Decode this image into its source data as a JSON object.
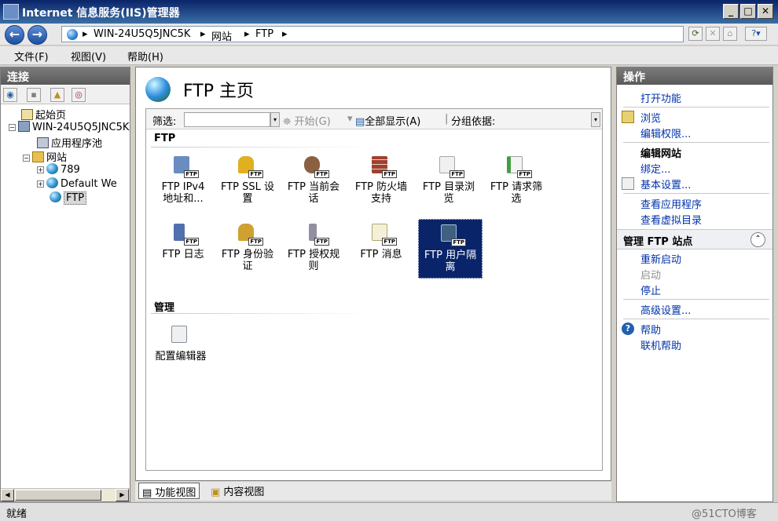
{
  "window": {
    "title": "Internet 信息服务(IIS)管理器",
    "min": "_",
    "max": "□",
    "close": "✕"
  },
  "address": {
    "back": "←",
    "forward": "→",
    "breadcrumb": [
      "WIN-24U5Q5JNC5K",
      "网站",
      "FTP"
    ],
    "sep": "▸",
    "help": "?"
  },
  "menu": [
    "文件(F)",
    "视图(V)",
    "帮助(H)"
  ],
  "connections": {
    "title": "连接",
    "tree": [
      {
        "label": "起始页",
        "icon": "start-page-icon",
        "level": 0
      },
      {
        "label": "WIN-24U5Q5JNC5K",
        "icon": "server-icon",
        "level": 0,
        "toggle": "−"
      },
      {
        "label": "应用程序池",
        "icon": "app-pool-icon",
        "level": 1
      },
      {
        "label": "网站",
        "icon": "sites-folder-icon",
        "level": 1,
        "toggle": "−"
      },
      {
        "label": "789",
        "icon": "globe-icon",
        "level": 2,
        "toggle": "+"
      },
      {
        "label": "Default We",
        "icon": "globe-icon",
        "level": 2,
        "toggle": "+"
      },
      {
        "label": "FTP",
        "icon": "globe-icon",
        "level": 2,
        "selected": true
      }
    ]
  },
  "main": {
    "title": "FTP 主页",
    "filter": {
      "label": "筛选:",
      "start": "开始(G)",
      "show_all": "全部显示(A)",
      "group_by": "分组依据:"
    },
    "sections": [
      {
        "name": "FTP",
        "features": [
          {
            "label1": "FTP IPv4",
            "label2": "地址和...",
            "icon": "ip-restrictions-icon",
            "color": "#6a8cc0"
          },
          {
            "label1": "FTP SSL 设",
            "label2": "置",
            "icon": "ssl-lock-icon",
            "color": "#e0b020"
          },
          {
            "label1": "FTP 当前会",
            "label2": "话",
            "icon": "sessions-users-icon",
            "color": "#8a6040"
          },
          {
            "label1": "FTP 防火墙",
            "label2": "支持",
            "icon": "firewall-icon",
            "color": "#a04030"
          },
          {
            "label1": "FTP 目录浏",
            "label2": "览",
            "icon": "directory-browsing-icon",
            "color": "#a0a8b0"
          },
          {
            "label1": "FTP 请求筛",
            "label2": "选",
            "icon": "request-filtering-icon",
            "color": "#40a040"
          },
          {
            "label1": "FTP 日志",
            "label2": "",
            "icon": "logging-icon",
            "color": "#5070b0"
          },
          {
            "label1": "FTP 身份验",
            "label2": "证",
            "icon": "authentication-icon",
            "color": "#d0a030"
          },
          {
            "label1": "FTP 授权规",
            "label2": "则",
            "icon": "authorization-key-icon",
            "color": "#9090a0"
          },
          {
            "label1": "FTP 消息",
            "label2": "",
            "icon": "messages-icon",
            "color": "#d8d0a0"
          },
          {
            "label1": "FTP 用户隔",
            "label2": "离",
            "icon": "user-isolation-icon",
            "color": "#406080",
            "selected": true
          }
        ]
      },
      {
        "name": "管理",
        "features": [
          {
            "label1": "配置编辑器",
            "label2": "",
            "icon": "config-editor-icon",
            "color": "#b0b8c0"
          }
        ]
      }
    ]
  },
  "views": {
    "features": "功能视图",
    "content": "内容视图"
  },
  "actions": {
    "title": "操作",
    "items": {
      "open_feature": "打开功能",
      "browse": "浏览",
      "edit_perms": "编辑权限...",
      "edit_site": "编辑网站",
      "bindings": "绑定...",
      "basic_settings": "基本设置...",
      "view_apps": "查看应用程序",
      "view_vdirs": "查看虚拟目录",
      "manage_ftp": "管理 FTP 站点",
      "restart": "重新启动",
      "start": "启动",
      "stop": "停止",
      "advanced": "高级设置...",
      "help": "帮助",
      "online_help": "联机帮助"
    }
  },
  "status": {
    "text": "就绪",
    "watermark": "@51CTO博客"
  }
}
